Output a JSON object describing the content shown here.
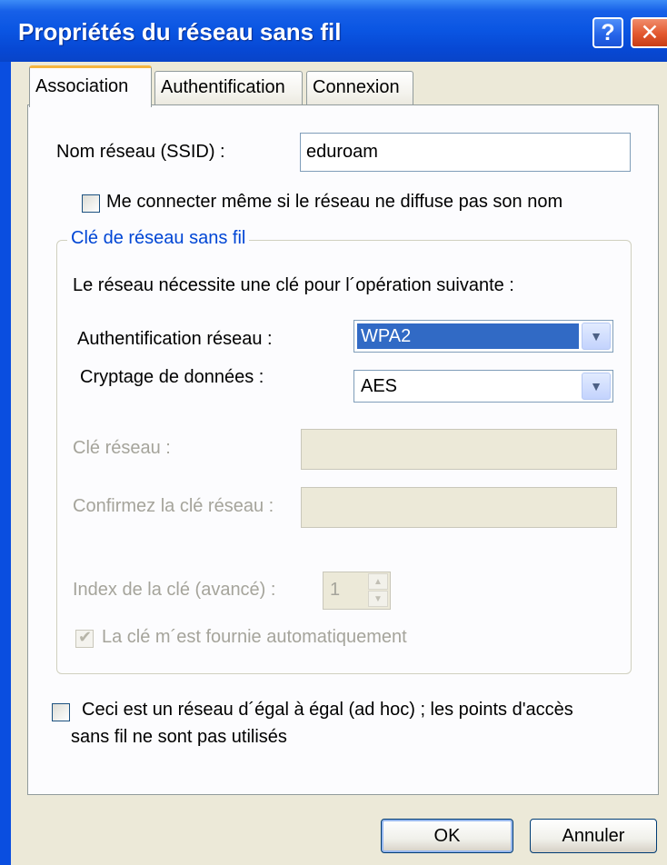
{
  "window": {
    "title": "Propriétés du réseau sans fil",
    "help_label": "?",
    "close_label": "✕"
  },
  "tabs": [
    {
      "label": "Association",
      "active": true
    },
    {
      "label": "Authentification",
      "active": false
    },
    {
      "label": "Connexion",
      "active": false
    }
  ],
  "ssid": {
    "label": "Nom réseau (SSID) :",
    "value": "eduroam"
  },
  "hidden_network": {
    "label": "Me connecter même si le réseau ne diffuse pas son nom",
    "checked": false
  },
  "key_group": {
    "title": "Clé de réseau sans fil",
    "description": "Le réseau nécessite une clé pour l´opération suivante :",
    "auth_label": "Authentification réseau :",
    "auth_value": "WPA2",
    "encryption_label": "Cryptage de données :",
    "encryption_value": "AES",
    "network_key_label": "Clé réseau :",
    "network_key_value": "",
    "confirm_key_label": "Confirmez la clé réseau :",
    "confirm_key_value": "",
    "key_index_label": "Index de la clé (avancé) :",
    "key_index_value": "1",
    "auto_key_label": "La clé m´est fournie automatiquement",
    "auto_key_checked": true
  },
  "adhoc": {
    "label_line1": "Ceci est un réseau d´égal à égal (ad hoc) ; les points d'accès",
    "label_line2": "sans fil ne sont pas utilisés",
    "checked": false
  },
  "buttons": {
    "ok": "OK",
    "cancel": "Annuler"
  },
  "colors": {
    "titlebar": "#0a55e2",
    "dialog_bg": "#ece9d8",
    "selection": "#316ac5",
    "group_title": "#0046d5"
  },
  "icons": {
    "dropdown": "chevron-down-icon",
    "check": "checkmark-icon"
  }
}
